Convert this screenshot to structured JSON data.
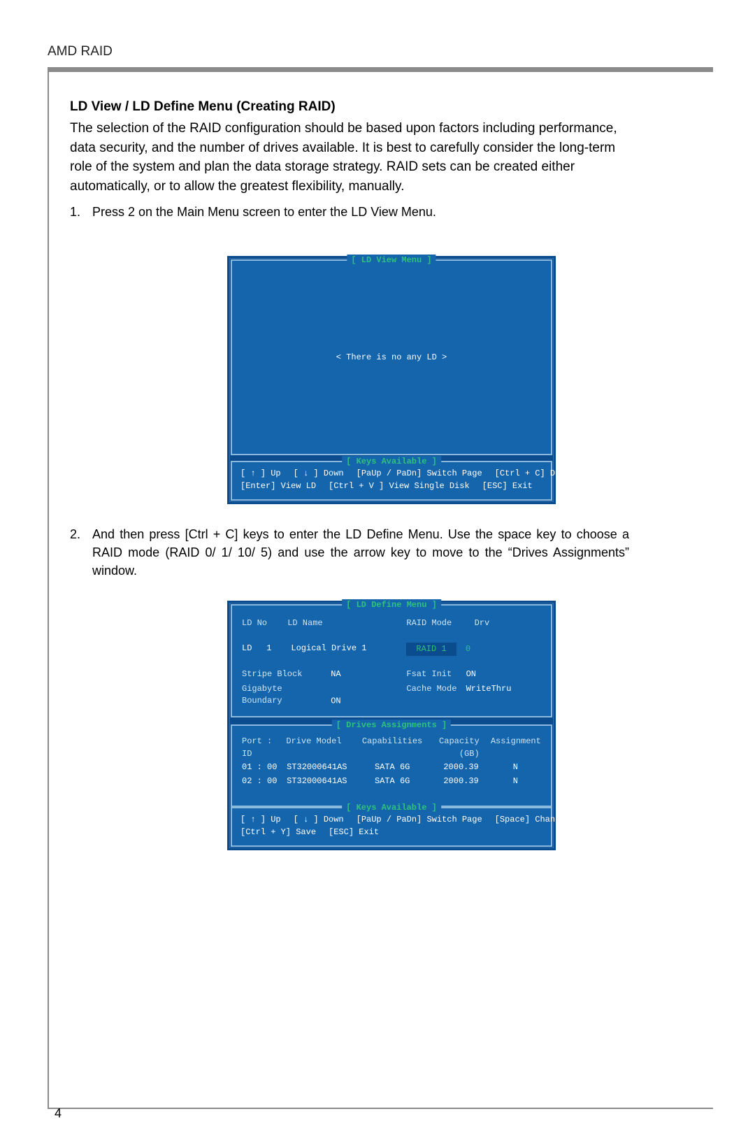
{
  "doc": {
    "title": "AMD RAID",
    "sectionHeading": "LD View / LD Define Menu (Creating RAID)",
    "intro": "The selection of the RAID configuration should be based upon factors including performance, data security, and the number of drives available. It is best to carefully consider the long-term role of the system and plan the data storage strategy. RAID sets can be created either automatically, or to allow the greatest flexibility, manually.",
    "step1": {
      "num": "1.",
      "text": "Press 2 on the Main Menu screen to enter the LD View Menu."
    },
    "step2": {
      "num": "2.",
      "text": "And then press [Ctrl + C] keys to enter the LD Define Menu. Use the space key to choose a RAID mode (RAID 0/ 1/ 10/ 5) and use the arrow key to move to the “Drives Assignments” window."
    },
    "pageNumber": "4"
  },
  "bios1": {
    "title": "[  LD View Menu  ]",
    "message": "< There is no any LD >",
    "keysTitle": "[ Keys Available ]",
    "keys": {
      "up": "[ ↑ ] Up",
      "down": "[ ↓ ] Down",
      "switchPage": "[PaUp / PaDn] Switch Page",
      "defineLD": "[Ctrl + C] Define LD",
      "viewLD": "[Enter] View LD",
      "viewSingle": "[Ctrl + V ] View Single Disk",
      "exit": "[ESC] Exit"
    }
  },
  "bios2": {
    "title": "[  LD Define Menu  ]",
    "header": {
      "ldNoLabel": "LD No",
      "ldNameLabel": "LD Name",
      "raidModeLabel": "RAID Mode",
      "drvLabel": "Drv",
      "ldNumPrefix": "LD",
      "ldNum": "1",
      "ldName": "Logical Drive 1",
      "raidMode": "RAID 1",
      "drv": "0",
      "stripeBlockLabel": "Stripe Block",
      "stripeBlock": "NA",
      "gigabyteBoundaryLabel": "Gigabyte Boundary",
      "gigabyteBoundary": "ON",
      "fsatInitLabel": "Fsat Init",
      "fsatInit": "ON",
      "cacheModeLabel": "Cache Mode",
      "cacheMode": "WriteThru"
    },
    "assignTitle": "[  Drives Assignments  ]",
    "columns": {
      "port": "Port  : ID",
      "model": "Drive Model",
      "cap": "Capabilities",
      "capacity": "Capacity (GB)",
      "assignment": "Assignment"
    },
    "rows": [
      {
        "port": "01 : 00",
        "model": "ST32000641AS",
        "cap": "SATA 6G",
        "capacity": "2000.39",
        "assignment": "N"
      },
      {
        "port": "02 : 00",
        "model": "ST32000641AS",
        "cap": "SATA 6G",
        "capacity": "2000.39",
        "assignment": "N"
      }
    ],
    "keysTitle": "[ Keys Available ]",
    "keys": {
      "up": "[ ↑ ] Up",
      "down": "[ ↓ ] Down",
      "switchPage": "[PaUp / PaDn] Switch Page",
      "changeOption": "[Space] Change Option",
      "save": "[Ctrl + Y] Save",
      "exit": "[ESC] Exit"
    }
  }
}
